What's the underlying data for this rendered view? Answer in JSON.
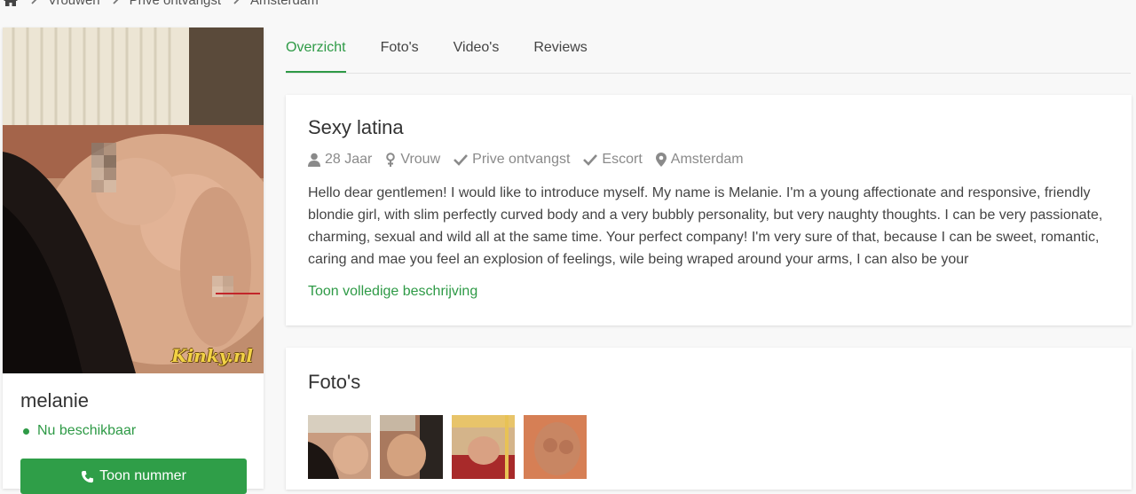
{
  "breadcrumb": {
    "items": [
      "Vrouwen",
      "Prive ontvangst",
      "Amsterdam"
    ]
  },
  "profile": {
    "watermark": "Kinky.nl",
    "name": "melanie",
    "availability": "Nu beschikbaar",
    "phone_button": "Toon nummer"
  },
  "tabs": [
    {
      "label": "Overzicht",
      "active": true
    },
    {
      "label": "Foto's",
      "active": false
    },
    {
      "label": "Video's",
      "active": false
    },
    {
      "label": "Reviews",
      "active": false
    }
  ],
  "overview": {
    "title": "Sexy latina",
    "meta": {
      "age": "28 Jaar",
      "gender": "Vrouw",
      "service1": "Prive ontvangst",
      "service2": "Escort",
      "location": "Amsterdam"
    },
    "description": "Hello dear gentlemen! I would like to introduce myself. My name is Melanie. I'm a young affectionate and responsive, friendly blondie girl, with slim perfectly curved body and a very bubbly personality, but very naughty thoughts. I can be very passionate, charming, sexual and wild all at the same time. Your perfect company! I'm very sure of that, because I can be sweet, romantic, caring and mae you feel an explosion of feelings, wile being wraped around your arms, I can also be your",
    "more_link": "Toon volledige beschrijving"
  },
  "photos": {
    "title": "Foto's",
    "count_visible": 4
  },
  "colors": {
    "accent": "#2e9a46",
    "button": "#2f9e48",
    "muted": "#8a8a8a"
  },
  "icons": {
    "home": "home-icon",
    "separator": "chevron-right-icon",
    "age": "user-icon",
    "gender": "venus-icon",
    "check": "check-icon",
    "location": "map-marker-icon",
    "phone": "phone-icon"
  }
}
